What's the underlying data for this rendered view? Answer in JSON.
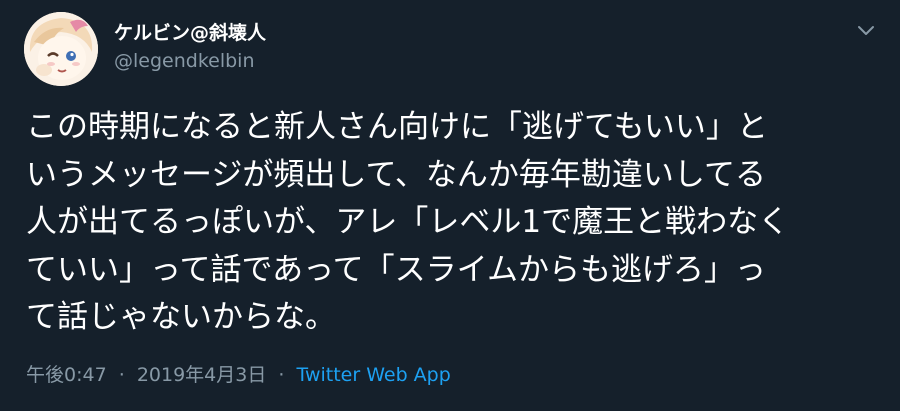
{
  "user": {
    "display_name": "ケルビン@斜壊人",
    "handle": "@legendkelbin"
  },
  "tweet": {
    "text": "この時期になると新人さん向けに「逃げてもいい」と\nいうメッセージが頻出して、なんか毎年勘違いしてる\n人が出てるっぽいが、アレ「レベル1で魔王と戦わなく\nていい」って話であって「スライムからも逃げろ」っ\nて話じゃないからな。",
    "time": "午後0:47",
    "separator": "·",
    "date": "2019年4月3日",
    "source": "Twitter Web App"
  },
  "icons": {
    "menu": "chevron-down-icon",
    "avatar": "anime-avatar-image"
  },
  "colors": {
    "background": "#15202b",
    "text": "#ffffff",
    "secondary": "#8899a6",
    "link": "#1da1f2"
  }
}
